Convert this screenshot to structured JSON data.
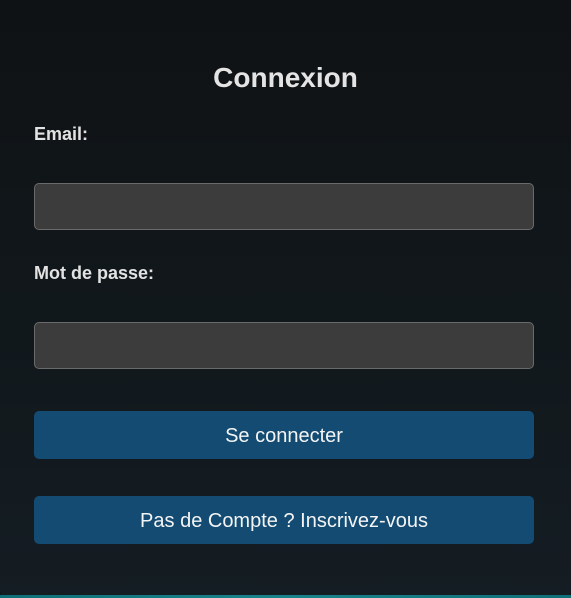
{
  "login_form": {
    "title": "Connexion",
    "email_label": "Email:",
    "email_value": "",
    "password_label": "Mot de passe:",
    "password_value": "",
    "login_button": "Se connecter",
    "signup_button": "Pas de Compte ? Inscrivez-vous"
  },
  "colors": {
    "background": "#0f1214",
    "input_background": "#3c3c3c",
    "button_background": "#134b72",
    "text": "#e4e4e4",
    "accent_bottom": "#19838c"
  }
}
